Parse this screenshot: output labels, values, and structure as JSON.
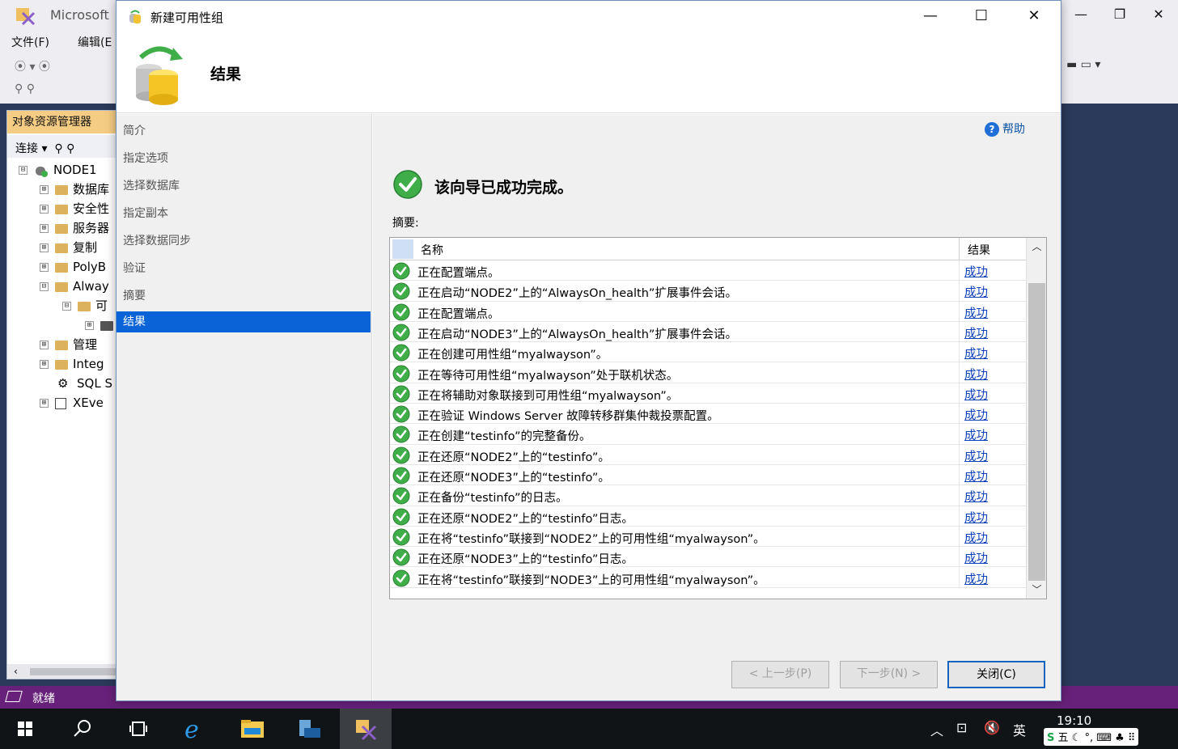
{
  "ssms": {
    "title": "Microsoft",
    "menu": [
      "文件(F)",
      "编辑(E"
    ],
    "object_explorer": {
      "tab": "对象资源管理器",
      "connect": "连接",
      "tree": [
        {
          "label": "NODE1",
          "expander": "⊟"
        },
        {
          "label": "数据库",
          "expander": "⊞"
        },
        {
          "label": "安全性",
          "expander": "⊞"
        },
        {
          "label": "服务器",
          "expander": "⊞"
        },
        {
          "label": "复制",
          "expander": "⊞"
        },
        {
          "label": "PolyB",
          "expander": "⊞"
        },
        {
          "label": "Alway",
          "expander": "⊟"
        },
        {
          "label": "可",
          "expander": "⊟"
        },
        {
          "label": "",
          "expander": "⊞"
        },
        {
          "label": "管理",
          "expander": "⊞"
        },
        {
          "label": "Integ",
          "expander": "⊞"
        },
        {
          "label": "SQL S",
          "expander": ""
        },
        {
          "label": "XEve",
          "expander": "⊞"
        }
      ]
    },
    "status": "就绪"
  },
  "dialog": {
    "title": "新建可用性组",
    "header_title": "结果",
    "nav": [
      "简介",
      "指定选项",
      "选择数据库",
      "指定副本",
      "选择数据同步",
      "验证",
      "摘要",
      "结果"
    ],
    "nav_selected_index": 7,
    "help": "帮助",
    "done_text": "该向导已成功完成。",
    "summary_label": "摘要:",
    "columns": {
      "name": "名称",
      "result": "结果"
    },
    "rows": [
      {
        "name": "正在配置端点。",
        "result": "成功"
      },
      {
        "name": "正在启动“NODE2”上的“AlwaysOn_health”扩展事件会话。",
        "result": "成功"
      },
      {
        "name": "正在配置端点。",
        "result": "成功"
      },
      {
        "name": "正在启动“NODE3”上的“AlwaysOn_health”扩展事件会话。",
        "result": "成功"
      },
      {
        "name": "正在创建可用性组“myalwayson”。",
        "result": "成功"
      },
      {
        "name": "正在等待可用性组“myalwayson”处于联机状态。",
        "result": "成功"
      },
      {
        "name": "正在将辅助对象联接到可用性组“myalwayson”。",
        "result": "成功"
      },
      {
        "name": "正在验证 Windows Server 故障转移群集仲裁投票配置。",
        "result": "成功"
      },
      {
        "name": "正在创建“testinfo”的完整备份。",
        "result": "成功"
      },
      {
        "name": "正在还原“NODE2”上的“testinfo”。",
        "result": "成功"
      },
      {
        "name": "正在还原“NODE3”上的“testinfo”。",
        "result": "成功"
      },
      {
        "name": "正在备份“testinfo”的日志。",
        "result": "成功"
      },
      {
        "name": "正在还原“NODE2”上的“testinfo”日志。",
        "result": "成功"
      },
      {
        "name": "正在将“testinfo”联接到“NODE2”上的可用性组“myalwayson”。",
        "result": "成功"
      },
      {
        "name": "正在还原“NODE3”上的“testinfo”日志。",
        "result": "成功"
      },
      {
        "name": "正在将“testinfo”联接到“NODE3”上的可用性组“myalwayson”。",
        "result": "成功"
      }
    ],
    "buttons": {
      "prev": "< 上一步(P)",
      "next": "下一步(N) >",
      "close": "关闭(C)"
    }
  },
  "taskbar": {
    "time": "19:10",
    "ime_lang": "英",
    "ime_mode": "五"
  },
  "colors": {
    "accent": "#0a64d8",
    "status_bar": "#68217a",
    "success": "#3fae49",
    "link": "#0b3fb8"
  }
}
